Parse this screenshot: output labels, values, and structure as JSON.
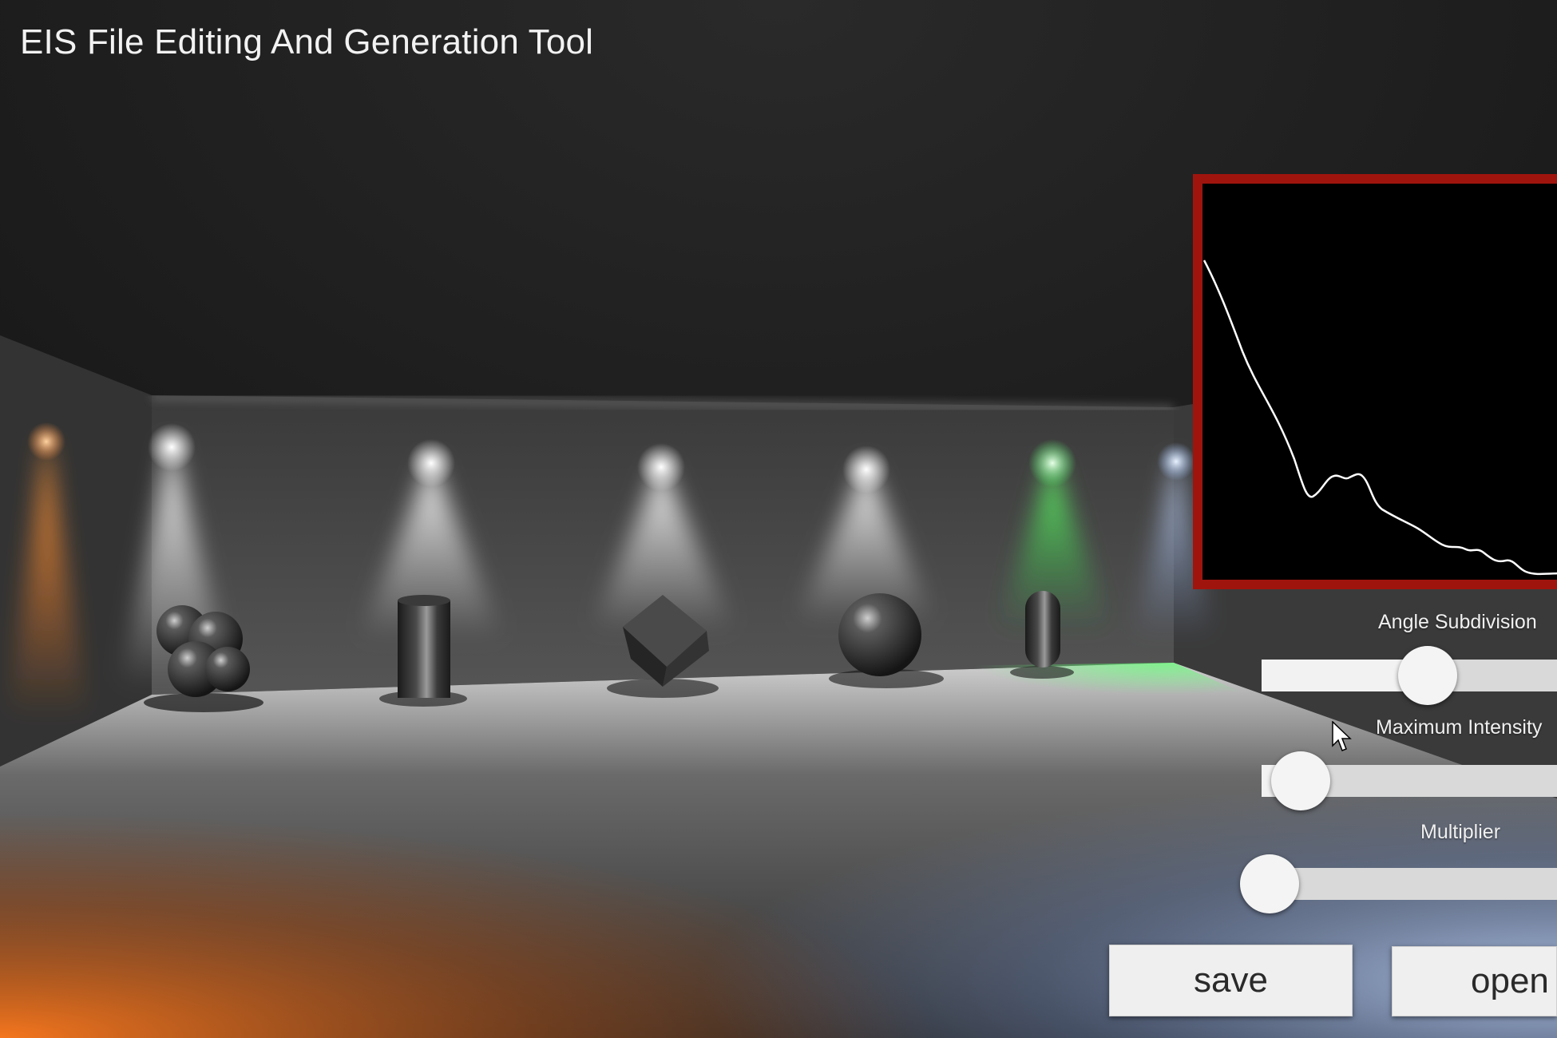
{
  "app": {
    "title": "EIS File Editing And Generation Tool"
  },
  "profile_graph": {
    "border_color": "#a0140e",
    "background_color": "#000000",
    "curve_color": "#ffffff"
  },
  "sliders": [
    {
      "label": "Angle Subdivision",
      "value_fraction": 0.5
    },
    {
      "label": "Maximum Intensity",
      "value_fraction": 0.1
    },
    {
      "label": "Multiplier",
      "value_fraction": 0.0
    }
  ],
  "buttons": {
    "save_label": "save",
    "open_label": "open"
  },
  "scene": {
    "light_colors": [
      "#ff8a3a",
      "#ffffff",
      "#ffffff",
      "#ffffff",
      "#ffffff",
      "#4dff66",
      "#9fc3ff"
    ],
    "objects": [
      "metaballs",
      "cylinder",
      "cube",
      "sphere",
      "capsule"
    ]
  }
}
